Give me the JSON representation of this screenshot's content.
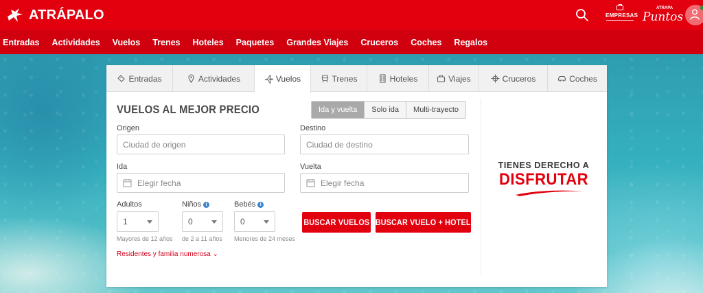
{
  "header": {
    "logo_text": "ATRÁPALO",
    "empresas_label": "EMPRESAS",
    "puntos_small": "ATRAPA",
    "puntos_label": "Puntos"
  },
  "nav": {
    "items": [
      "Entradas",
      "Actividades",
      "Vuelos",
      "Trenes",
      "Hoteles",
      "Paquetes",
      "Grandes Viajes",
      "Cruceros",
      "Coches",
      "Regalos"
    ]
  },
  "tabs": {
    "items": [
      {
        "label": "Entradas",
        "icon": "ticket-icon"
      },
      {
        "label": "Actividades",
        "icon": "pin-icon"
      },
      {
        "label": "Vuelos",
        "icon": "plane-icon",
        "active": true
      },
      {
        "label": "Trenes",
        "icon": "train-icon"
      },
      {
        "label": "Hoteles",
        "icon": "building-icon"
      },
      {
        "label": "Viajes",
        "icon": "suitcase-icon"
      },
      {
        "label": "Cruceros",
        "icon": "wheel-icon"
      },
      {
        "label": "Coches",
        "icon": "car-icon"
      }
    ]
  },
  "form": {
    "title": "VUELOS AL MEJOR PRECIO",
    "trip_types": [
      "Ida y vuelta",
      "Solo ida",
      "Multi-trayecto"
    ],
    "trip_selected": "Ida y vuelta",
    "origen_label": "Origen",
    "origen_placeholder": "Ciudad de origen",
    "destino_label": "Destino",
    "destino_placeholder": "Ciudad de destino",
    "ida_label": "Ida",
    "ida_placeholder": "Elegir fecha",
    "vuelta_label": "Vuelta",
    "vuelta_placeholder": "Elegir fecha",
    "adultos_label": "Adultos",
    "adultos_value": "1",
    "adultos_hint": "Mayores de 12 años",
    "ninos_label": "Niños",
    "ninos_value": "0",
    "ninos_hint": "de 2 a 11 años",
    "bebes_label": "Bebés",
    "bebes_value": "0",
    "bebes_hint": "Menores de 24 meses",
    "buscar_vuelos": "BUSCAR VUELOS",
    "buscar_vuelo_hotel": "BUSCAR VUELO + HOTEL",
    "residentes": "Residentes y familia numerosa"
  },
  "promo": {
    "line1": "TIENES DERECHO A",
    "line2": "DISFRUTAR"
  },
  "colors": {
    "brand_red": "#e2000f",
    "nav_red": "#d0000e",
    "toggle_active": "#a9a9a9",
    "info_blue": "#3a86d0"
  }
}
